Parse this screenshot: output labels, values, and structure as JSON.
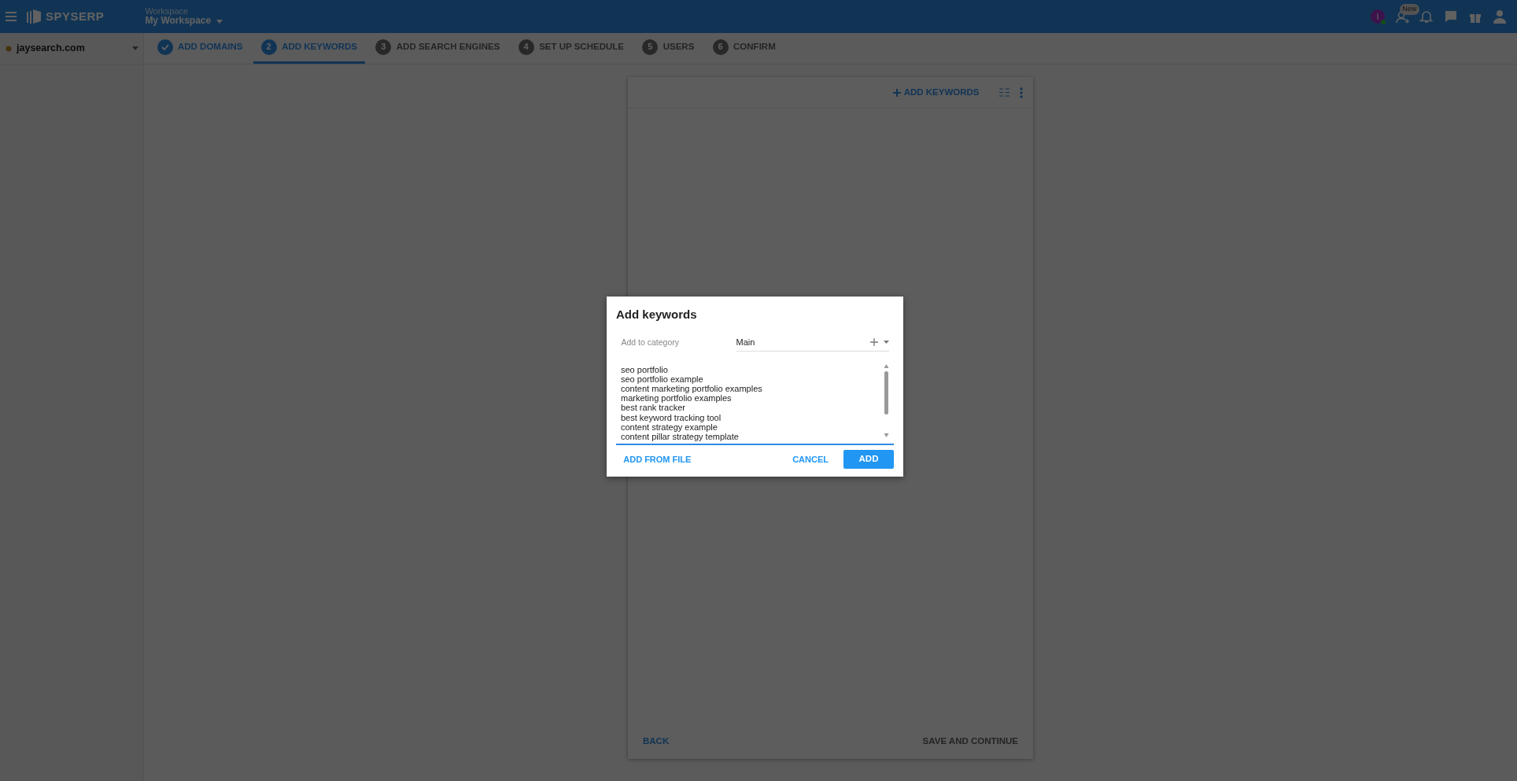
{
  "header": {
    "brand": "SPYSERP",
    "workspace_label": "Workspace",
    "workspace_name": "My Workspace",
    "avatar_initial": "I",
    "new_badge": "New"
  },
  "sidebar": {
    "domain": "jaysearch.com"
  },
  "steps": [
    {
      "label": "ADD DOMAINS",
      "done": true,
      "selected": false
    },
    {
      "number": "2",
      "label": "ADD KEYWORDS",
      "done": false,
      "selected": true
    },
    {
      "number": "3",
      "label": "ADD SEARCH ENGINES",
      "done": false,
      "selected": false
    },
    {
      "number": "4",
      "label": "SET UP SCHEDULE",
      "done": false,
      "selected": false
    },
    {
      "number": "5",
      "label": "USERS",
      "done": false,
      "selected": false
    },
    {
      "number": "6",
      "label": "CONFIRM",
      "done": false,
      "selected": false
    }
  ],
  "card": {
    "add_keywords": "ADD KEYWORDS",
    "back": "BACK",
    "save_continue": "SAVE AND CONTINUE",
    "save_disabled": true
  },
  "dialog": {
    "title": "Add keywords",
    "category_label": "Add to category",
    "category_value": "Main",
    "keywords": [
      "seo portfolio",
      "seo portfolio example",
      "content marketing portfolio examples",
      "marketing portfolio examples",
      "best rank tracker",
      "best keyword tracking tool",
      "content strategy example",
      "content pillar strategy template"
    ],
    "add_from_file": "ADD FROM FILE",
    "cancel": "CANCEL",
    "add": "ADD"
  }
}
